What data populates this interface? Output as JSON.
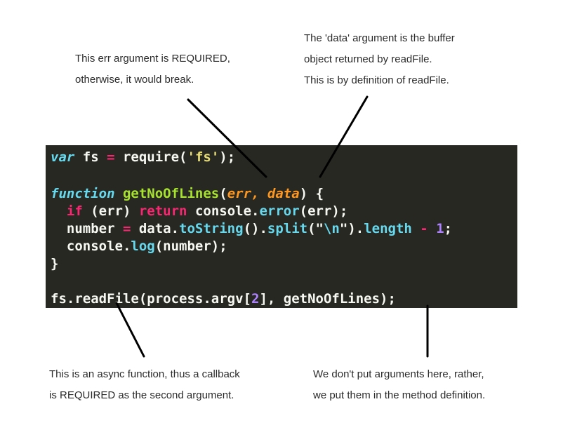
{
  "annotations": {
    "err_required": [
      "This err argument is REQUIRED,",
      "otherwise, it would break."
    ],
    "data_argument": [
      "The 'data' argument is the buffer",
      "object returned by readFile.",
      "This is by definition of readFile."
    ],
    "async_callback": [
      "This is an async function, thus a callback",
      "is REQUIRED as the second argument."
    ],
    "no_arguments": [
      "We don't put arguments here, rather,",
      "we put them in the method definition."
    ]
  },
  "code": {
    "background": "#272822",
    "colors": {
      "keyword": "#66d9ef",
      "function_name": "#a6e22e",
      "parameter": "#fd971f",
      "operator": "#f92672",
      "string": "#e6db74",
      "number": "#ae81ff",
      "text": "#f8f8f2"
    },
    "lines": [
      [
        {
          "t": "var",
          "k": "kw-var"
        },
        {
          "t": " fs ",
          "k": "plain"
        },
        {
          "t": "=",
          "k": "op"
        },
        {
          "t": " require(",
          "k": "plain"
        },
        {
          "t": "'fs'",
          "k": "str"
        },
        {
          "t": ");",
          "k": "plain"
        }
      ],
      [],
      [
        {
          "t": "function",
          "k": "kw-fn"
        },
        {
          "t": " ",
          "k": "plain"
        },
        {
          "t": "getNoOfLines",
          "k": "fn-name"
        },
        {
          "t": "(",
          "k": "plain"
        },
        {
          "t": "err",
          "k": "param"
        },
        {
          "t": ", ",
          "k": "param"
        },
        {
          "t": "data",
          "k": "param"
        },
        {
          "t": ") {",
          "k": "plain"
        }
      ],
      [
        {
          "t": "  ",
          "k": "plain"
        },
        {
          "t": "if",
          "k": "kw-if"
        },
        {
          "t": " (err) ",
          "k": "plain"
        },
        {
          "t": "return",
          "k": "kw-return"
        },
        {
          "t": " console.",
          "k": "plain"
        },
        {
          "t": "error",
          "k": "method"
        },
        {
          "t": "(err);",
          "k": "plain"
        }
      ],
      [
        {
          "t": "  number ",
          "k": "plain"
        },
        {
          "t": "=",
          "k": "op"
        },
        {
          "t": " data.",
          "k": "plain"
        },
        {
          "t": "toString",
          "k": "method"
        },
        {
          "t": "().",
          "k": "plain"
        },
        {
          "t": "split",
          "k": "method"
        },
        {
          "t": "(\"",
          "k": "plain"
        },
        {
          "t": "\\n",
          "k": "method"
        },
        {
          "t": "\").",
          "k": "plain"
        },
        {
          "t": "length",
          "k": "method"
        },
        {
          "t": " ",
          "k": "plain"
        },
        {
          "t": "-",
          "k": "op"
        },
        {
          "t": " ",
          "k": "plain"
        },
        {
          "t": "1",
          "k": "num"
        },
        {
          "t": ";",
          "k": "plain"
        }
      ],
      [
        {
          "t": "  console.",
          "k": "plain"
        },
        {
          "t": "log",
          "k": "method"
        },
        {
          "t": "(number);",
          "k": "plain"
        }
      ],
      [
        {
          "t": "}",
          "k": "plain"
        }
      ],
      [],
      [
        {
          "t": "fs.readFile(process.argv[",
          "k": "plain"
        },
        {
          "t": "2",
          "k": "num"
        },
        {
          "t": "], getNoOfLines);",
          "k": "plain"
        }
      ]
    ]
  }
}
